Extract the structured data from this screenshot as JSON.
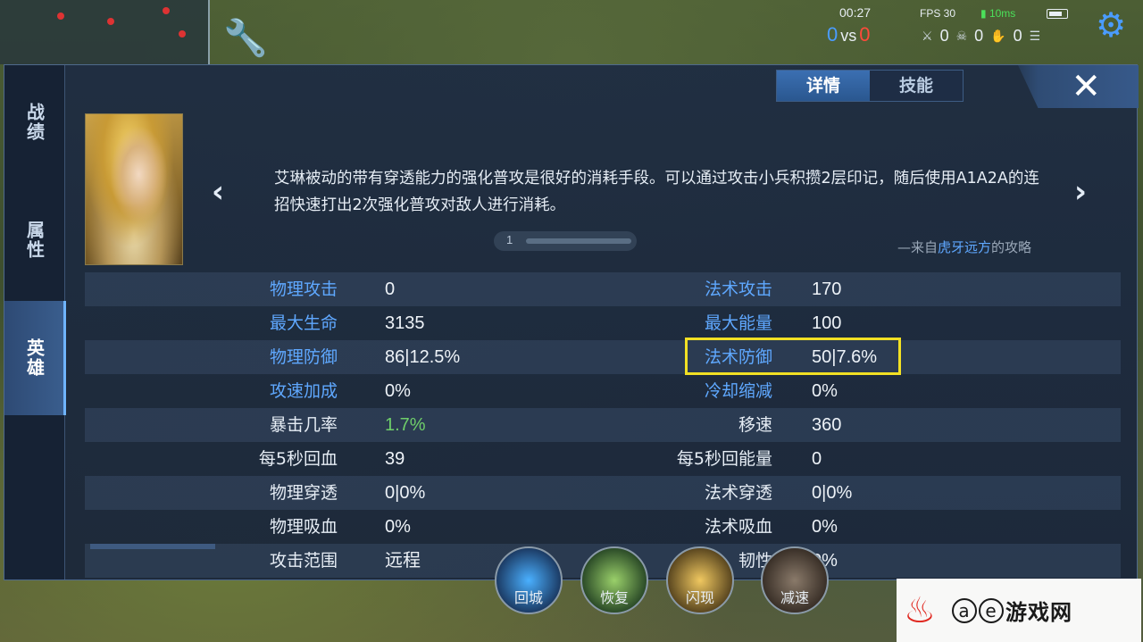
{
  "hud": {
    "time": "00:27",
    "fps": "FPS 30",
    "ping": "10ms",
    "score_blue": "0",
    "vs": "vs",
    "score_red": "0",
    "kills": "0",
    "deaths": "0",
    "assists": "0"
  },
  "tabs": {
    "details": "详情",
    "skills": "技能"
  },
  "sidebar": {
    "items": [
      {
        "label": "战绩"
      },
      {
        "label": "属性"
      },
      {
        "label": "英雄"
      }
    ]
  },
  "tip": {
    "text": "艾琳被动的带有穿透能力的强化普攻是很好的消耗手段。可以通过攻击小兵积攒2层印记，随后使用A1A2A的连招快速打出2次强化普攻对敌人进行消耗。",
    "page": "1",
    "source_prefix": "—来自",
    "source_author": "虎牙远方",
    "source_suffix": "的攻略"
  },
  "stats": [
    {
      "l1": "物理攻击",
      "v1": "0",
      "l2": "法术攻击",
      "v2": "170"
    },
    {
      "l1": "最大生命",
      "v1": "3135",
      "l2": "最大能量",
      "v2": "100"
    },
    {
      "l1": "物理防御",
      "v1": "86|12.5%",
      "l2": "法术防御",
      "v2": "50|7.6%"
    },
    {
      "l1": "攻速加成",
      "v1": "0%",
      "l2": "冷却缩减",
      "v2": "0%"
    },
    {
      "l1": "暴击几率",
      "v1": "1.7%",
      "l2": "移速",
      "v2": "360"
    },
    {
      "l1": "每5秒回血",
      "v1": "39",
      "l2": "每5秒回能量",
      "v2": "0"
    },
    {
      "l1": "物理穿透",
      "v1": "0|0%",
      "l2": "法术穿透",
      "v2": "0|0%"
    },
    {
      "l1": "物理吸血",
      "v1": "0%",
      "l2": "法术吸血",
      "v2": "0%"
    },
    {
      "l1": "攻击范围",
      "v1": "远程",
      "l2": "韧性",
      "v2": "0%"
    }
  ],
  "skills": {
    "recall": "回城",
    "heal": "恢复",
    "flash": "闪现",
    "slow": "减速"
  },
  "watermark": {
    "a": "a",
    "e": "e",
    "text": "游戏网"
  },
  "colors": {
    "accent_blue": "#5fa8ff",
    "highlight_yellow": "#f2e024",
    "crit_green": "#6fcf6a"
  }
}
